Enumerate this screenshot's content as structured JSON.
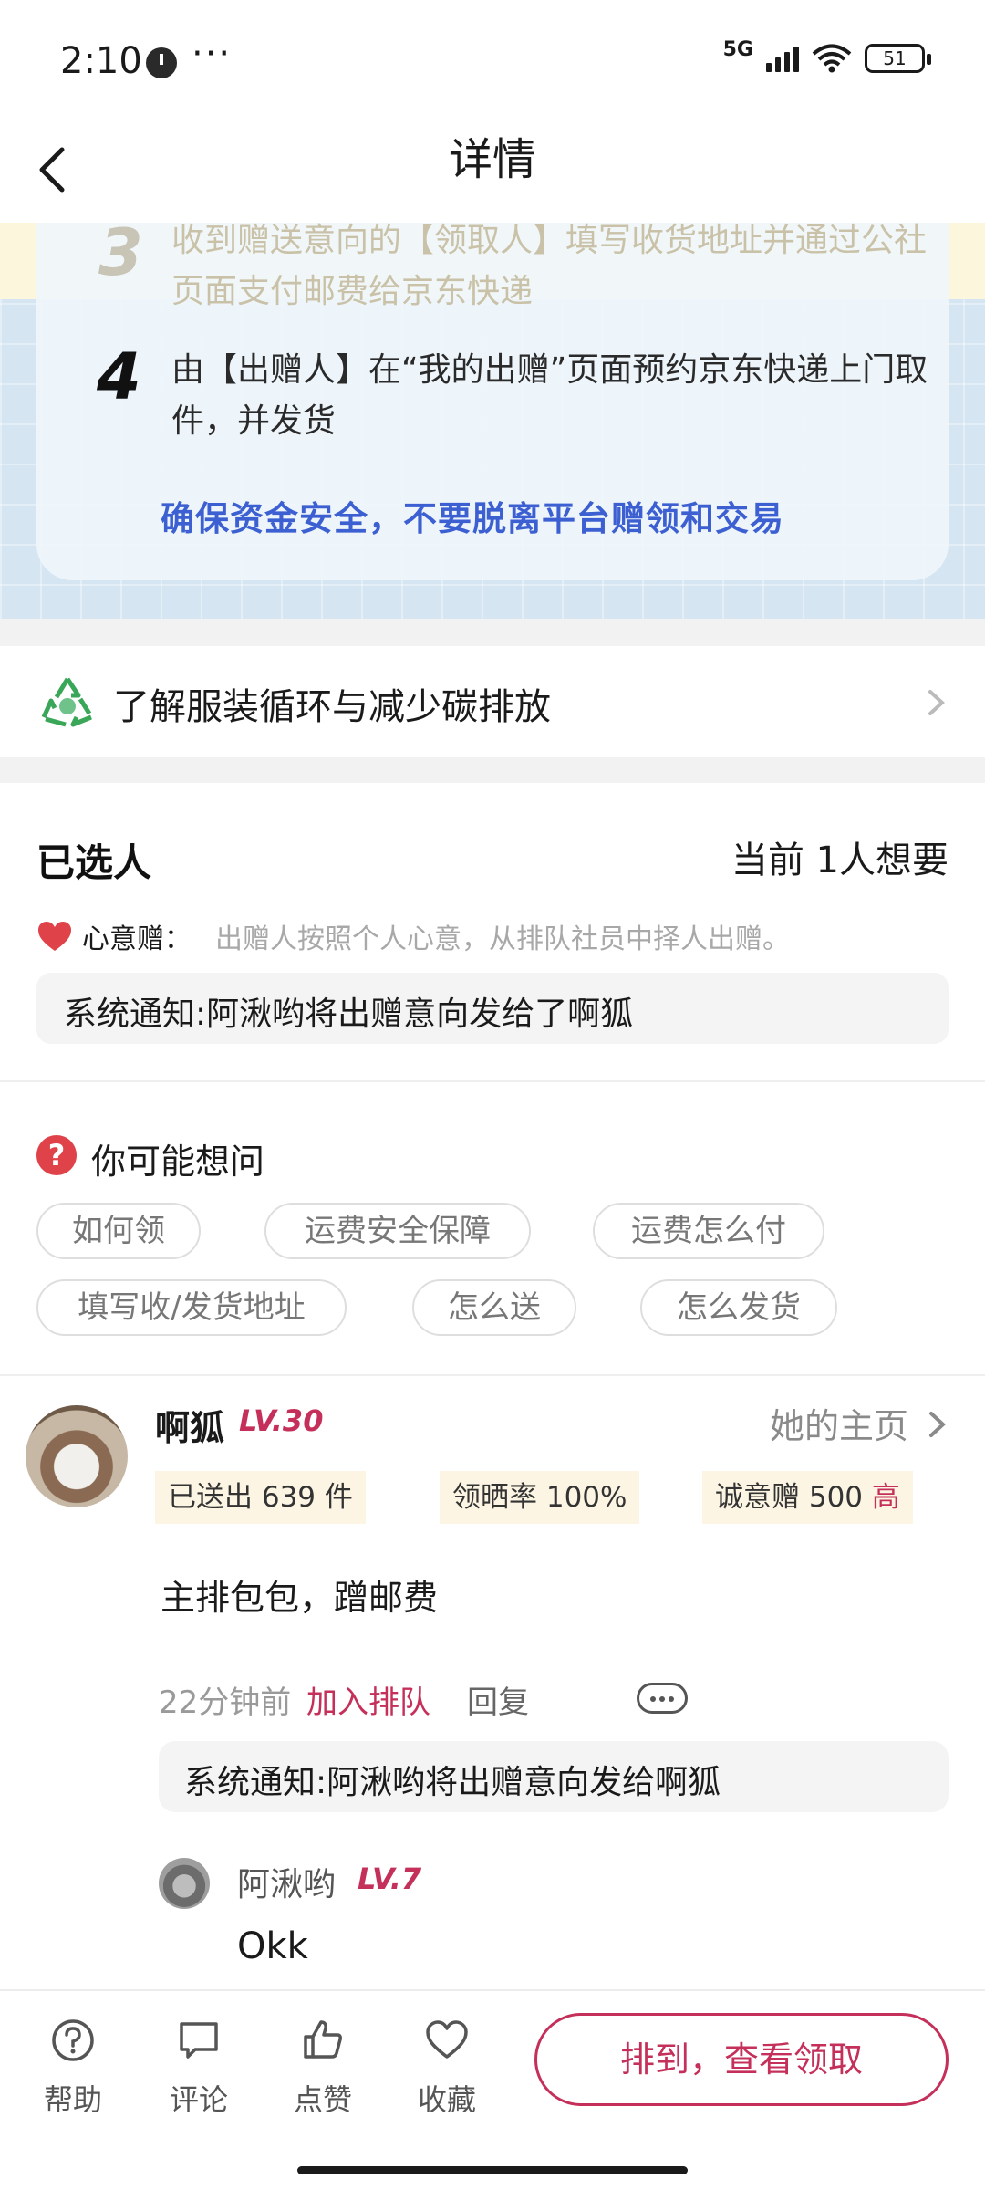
{
  "status_bar": {
    "time": "2:10",
    "dots": "···",
    "network": "5G",
    "battery": "51"
  },
  "nav": {
    "title": "详情"
  },
  "steps": {
    "step3_num": "3",
    "step3_text": "收到赠送意向的【领取人】填写收货地址并通过公社页面支付邮费给京东快递",
    "step4_num": "4",
    "step4_text": "由【出赠人】在“我的出赠”页面预约京东快递上门取件，并发货",
    "safety": "确保资金安全，不要脱离平台赠领和交易"
  },
  "eco": {
    "label": "了解服装循环与减少碳排放"
  },
  "selected": {
    "title": "已选人",
    "count": "当前 1人想要",
    "heart_label": "心意赠：",
    "heart_desc": "出赠人按照个人心意，从排队社员中择人出赠。",
    "notice": "系统通知:阿湫哟将出赠意向发给了啊狐"
  },
  "faq": {
    "title": "你可能想问",
    "tags": [
      "如何领",
      "运费安全保障",
      "运费怎么付",
      "填写收/发货地址",
      "怎么送",
      "怎么发货"
    ]
  },
  "comment": {
    "name": "啊狐",
    "level": "LV.30",
    "home_link": "她的主页",
    "stats": [
      {
        "label": "已送出 639 件",
        "hi": ""
      },
      {
        "label": "领晒率 100%",
        "hi": ""
      },
      {
        "label": "诚意赠 500 ",
        "hi": "高"
      }
    ],
    "body": "主排包包，蹭邮费",
    "time": "22分钟前",
    "join": "加入排队",
    "reply": "回复",
    "notice": "系统通知:阿湫哟将出赠意向发给啊狐",
    "reply_item": {
      "name": "阿湫哟",
      "level": "LV.7",
      "text": "Okk"
    }
  },
  "bottom_bar": {
    "items": [
      "帮助",
      "评论",
      "点赞",
      "收藏"
    ],
    "cta": "排到，查看领取"
  },
  "colors": {
    "accent": "#c4305a",
    "link_blue": "#3c5fd1",
    "steps_bg": "#d6e5f2"
  }
}
